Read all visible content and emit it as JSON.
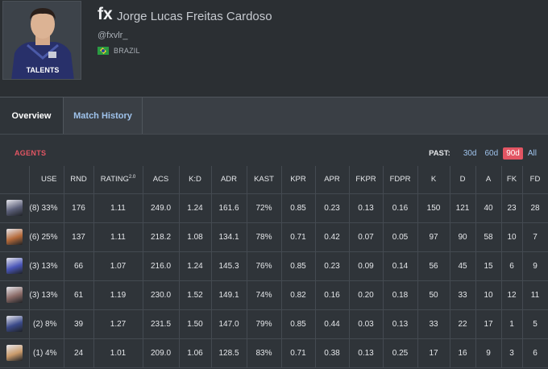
{
  "player": {
    "alias": "fx",
    "real_name": "Jorge Lucas Freitas Cardoso",
    "handle": "@fxvlr_",
    "country": "BRAZIL",
    "jersey_text": "TALENTS"
  },
  "tabs": [
    {
      "label": "Overview",
      "active": true
    },
    {
      "label": "Match History",
      "active": false
    }
  ],
  "agents_panel": {
    "title": "AGENTS",
    "past_label": "PAST:",
    "past_options": [
      {
        "label": "30d",
        "active": false
      },
      {
        "label": "60d",
        "active": false
      },
      {
        "label": "90d",
        "active": true
      },
      {
        "label": "All",
        "active": false
      }
    ],
    "columns": [
      "USE",
      "RND",
      "RATING",
      "ACS",
      "K:D",
      "ADR",
      "KAST",
      "KPR",
      "APR",
      "FKPR",
      "FDPR",
      "K",
      "D",
      "A",
      "FK",
      "FD"
    ],
    "rating_sup": "2.0",
    "rows": [
      {
        "icon_color": "#5b5f78",
        "cells": [
          "(8) 33%",
          "176",
          "1.11",
          "249.0",
          "1.24",
          "161.6",
          "72%",
          "0.85",
          "0.23",
          "0.13",
          "0.16",
          "150",
          "121",
          "40",
          "23",
          "28"
        ]
      },
      {
        "icon_color": "#b56a3a",
        "cells": [
          "(6) 25%",
          "137",
          "1.11",
          "218.2",
          "1.08",
          "134.1",
          "78%",
          "0.71",
          "0.42",
          "0.07",
          "0.05",
          "97",
          "90",
          "58",
          "10",
          "7"
        ]
      },
      {
        "icon_color": "#4a56b8",
        "cells": [
          "(3) 13%",
          "66",
          "1.07",
          "216.0",
          "1.24",
          "145.3",
          "76%",
          "0.85",
          "0.23",
          "0.09",
          "0.14",
          "56",
          "45",
          "15",
          "6",
          "9"
        ]
      },
      {
        "icon_color": "#8a6a66",
        "cells": [
          "(3) 13%",
          "61",
          "1.19",
          "230.0",
          "1.52",
          "149.1",
          "74%",
          "0.82",
          "0.16",
          "0.20",
          "0.18",
          "50",
          "33",
          "10",
          "12",
          "11"
        ]
      },
      {
        "icon_color": "#3b4a8a",
        "cells": [
          "(2) 8%",
          "39",
          "1.27",
          "231.5",
          "1.50",
          "147.0",
          "79%",
          "0.85",
          "0.44",
          "0.03",
          "0.13",
          "33",
          "22",
          "17",
          "1",
          "5"
        ]
      },
      {
        "icon_color": "#c99a6a",
        "cells": [
          "(1) 4%",
          "24",
          "1.01",
          "209.0",
          "1.06",
          "128.5",
          "83%",
          "0.71",
          "0.38",
          "0.13",
          "0.25",
          "17",
          "16",
          "9",
          "3",
          "6"
        ]
      }
    ]
  }
}
